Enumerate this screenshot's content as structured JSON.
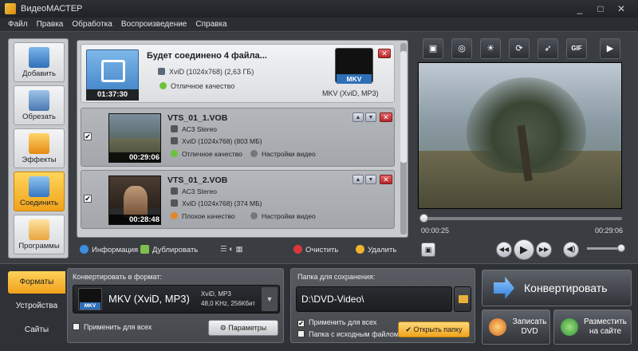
{
  "window": {
    "title": "ВидеоМАСТЕР",
    "controls": [
      "_",
      "□",
      "✕"
    ]
  },
  "menu": [
    "Файл",
    "Правка",
    "Обработка",
    "Воспроизведение",
    "Справка"
  ],
  "tools": [
    {
      "label": "Добавить",
      "icon": "add-video-icon"
    },
    {
      "label": "Обрезать",
      "icon": "scissors-icon"
    },
    {
      "label": "Эффекты",
      "icon": "sparkle-icon"
    },
    {
      "label": "Соединить",
      "icon": "merge-icon"
    },
    {
      "label": "Программы",
      "icon": "apps-icon"
    }
  ],
  "merge": {
    "duration": "01:37:30",
    "title": "Будет соединено 4 файла...",
    "info": "XviD (1024x768) (2,63 ГБ)",
    "quality": "Отличное качество",
    "format_tag": "MKV",
    "format_caption": "MKV (XviD, MP3)"
  },
  "clips": [
    {
      "name": "VTS_01_1.VOB",
      "duration": "00:29:06",
      "audio": "AC3 Stereo",
      "video": "XviD (1024x768) (803 МБ)",
      "quality": "Отличное качество",
      "quality_color": "#6cc23a",
      "settings": "Настройки видео",
      "checked": "✔"
    },
    {
      "name": "VTS_01_2.VOB",
      "duration": "00:28:48",
      "audio": "AC3 Stereo",
      "video": "XviD (1024x768) (374 МБ)",
      "quality": "Плохое качество",
      "quality_color": "#e8842a",
      "settings": "Настройки видео",
      "checked": "✔"
    }
  ],
  "listbar": {
    "info": "Информация",
    "duplicate": "Дублировать",
    "clear": "Очистить",
    "delete": "Удалить"
  },
  "player": {
    "current_time": "00:00:25",
    "total_time": "00:29:06",
    "progress": 0.014,
    "tools": [
      "crop-icon",
      "disc-icon",
      "brightness-icon",
      "rotate-icon",
      "speed-icon",
      "gif-icon",
      "fullscreen-icon"
    ],
    "gif_label": "GIF"
  },
  "bottom_tabs": [
    "Форматы",
    "Устройства",
    "Сайты"
  ],
  "convert": {
    "label": "Конвертировать в формат:",
    "format_tag": "MKV",
    "format_name": "MKV (XviD, MP3)",
    "detail_1": "XviD, MP3",
    "detail_2": "48,0 KHz, 256Кбит",
    "apply_all": "Применить для всех",
    "params": "Параметры"
  },
  "save": {
    "label": "Папка для сохранения:",
    "path": "D:\\DVD-Video\\",
    "apply_all": "Применить для всех",
    "source_folder": "Папка с исходным файлом",
    "open_folder": "Открыть папку"
  },
  "actions": {
    "convert": "Конвертировать",
    "dvd_line1": "Записать",
    "dvd_line2": "DVD",
    "share_line1": "Разместить",
    "share_line2": "на сайте"
  },
  "colors": {
    "accent": "#f0a21c",
    "close": "#b3262b",
    "format_blue": "#2f6fb7"
  }
}
